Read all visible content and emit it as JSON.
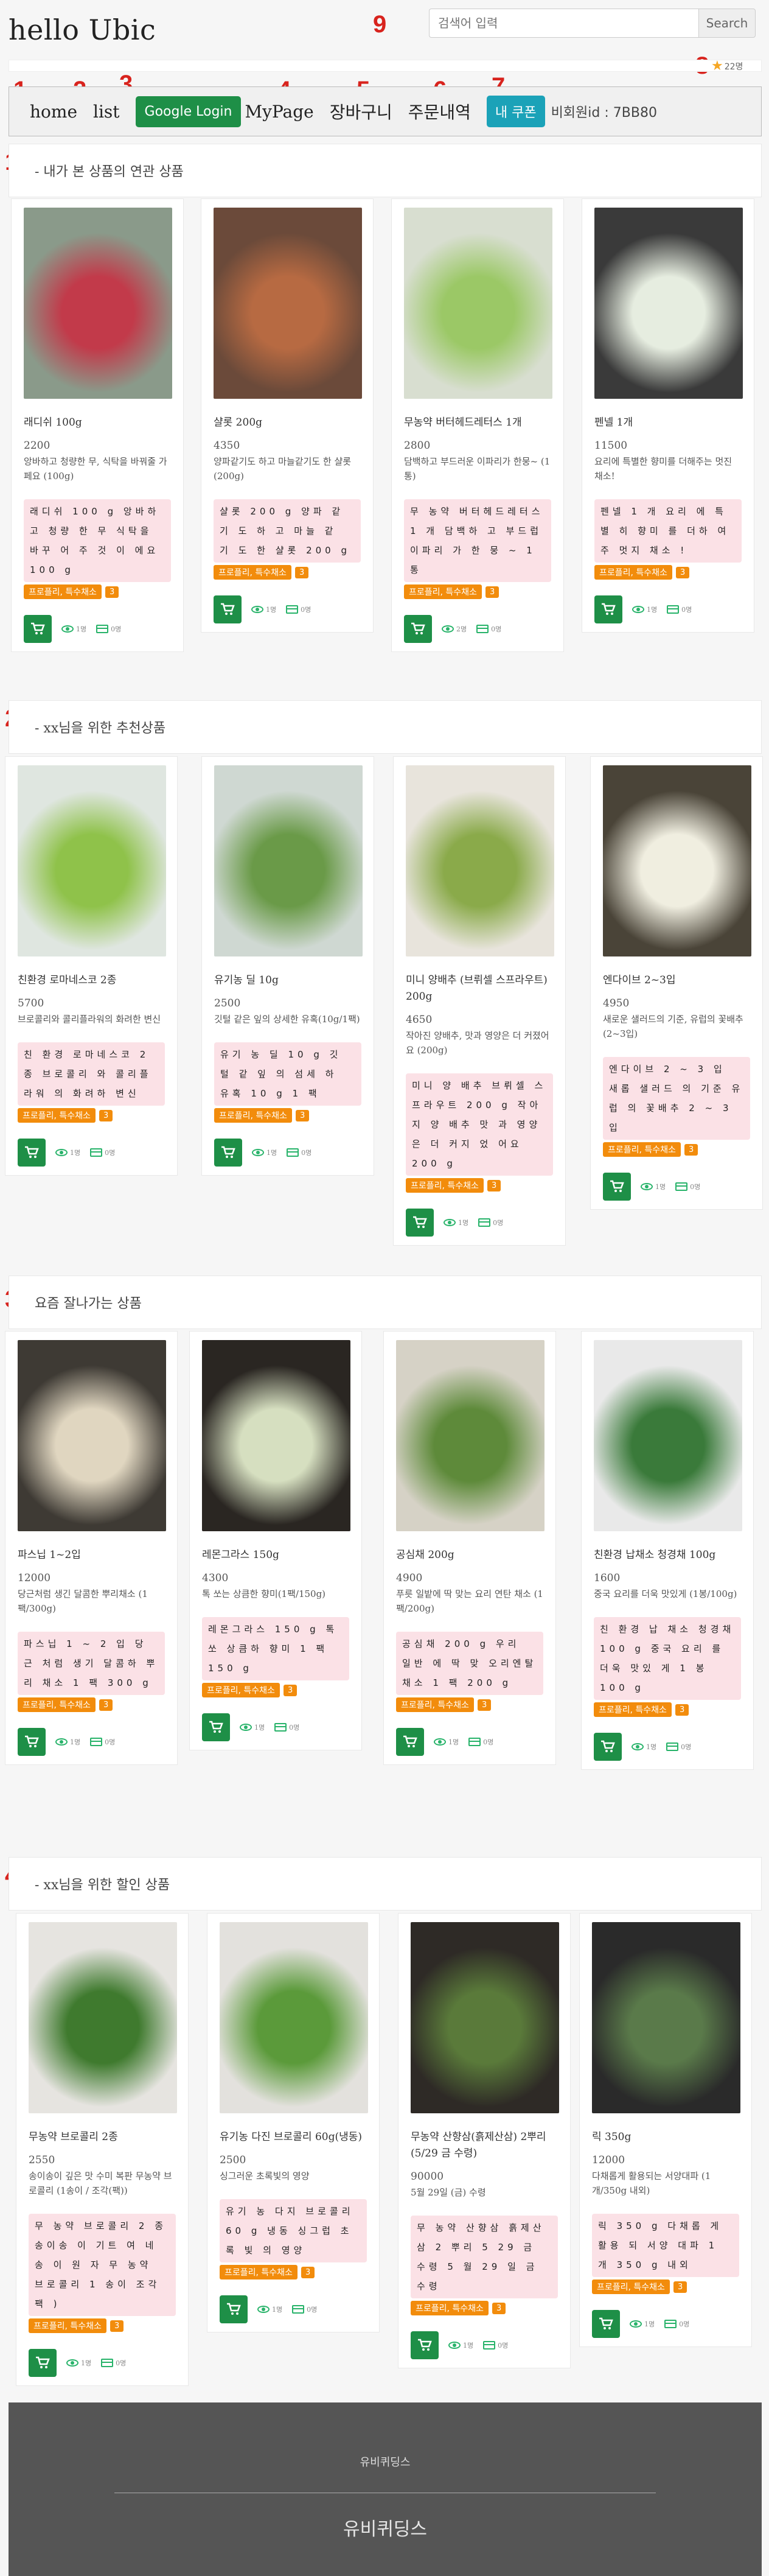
{
  "site": {
    "title": "hello Ubic"
  },
  "search": {
    "placeholder": "검색어 입력",
    "button": "Search"
  },
  "stat": {
    "count": "22명"
  },
  "nav": {
    "home": "home",
    "list": "list",
    "login": "Google Login",
    "mypage": "MyPage",
    "cart": "장바구니",
    "orders": "주문내역",
    "coupon": "내 쿠폰",
    "member": "비회원id : 7BB80"
  },
  "markers": [
    "1",
    "2",
    "3",
    "4",
    "5",
    "6",
    "7",
    "8",
    "9"
  ],
  "sections": [
    {
      "marker": "1",
      "title": "- 내가 본 상품의 연관 상품"
    },
    {
      "marker": "2",
      "title": "- xx님을 위한 추천상품"
    },
    {
      "marker": "3",
      "title": "요즘 잘나가는 상품"
    },
    {
      "marker": "4",
      "title": "- xx님을 위한 할인 상품"
    }
  ],
  "tags": {
    "store": "프로플리, 특수채소",
    "num": "3"
  },
  "products": [
    [
      {
        "name": "래디쉬 100g",
        "price": "2200",
        "desc": "앙바하고 청량한 무, 식탁을 바꿔줄 가페요 (100g)",
        "pink": "래디쉬 100 g 앙바하고 청량 한 무 식탁을 바꾸 어 주 것 이 에요 100 g",
        "views": "1명",
        "likes": "0명"
      },
      {
        "name": "샬롯 200g",
        "price": "4350",
        "desc": "양파같기도 하고 마늘같기도 한 샬롯 (200g)",
        "pink": "샬롯 200 g 양파 같 기 도 하 고 마늘 같 기 도 한 샬롯 200 g",
        "views": "1명",
        "likes": "0명"
      },
      {
        "name": "무농약 버터헤드레터스 1개",
        "price": "2800",
        "desc": "담백하고 부드러운 이파리가 한뭉~ (1통)",
        "pink": "무 농약 버터헤드레터스 1 개 담백하 고 부드럽 이파리 가 한 뭉 ~ 1 통",
        "views": "2명",
        "likes": "0명"
      },
      {
        "name": "펜넬 1개",
        "price": "11500",
        "desc": "요리에 특별한 향미를 더해주는 멋진 채소!",
        "pink": "펜넬 1 개 요리 에 특별 히 향미 를 더하 여 주 멋지 채소 !",
        "views": "1명",
        "likes": "0명"
      }
    ],
    [
      {
        "name": "친환경 로마네스코 2종",
        "price": "5700",
        "desc": "브로콜리와 콜리플라워의 화려한 변신",
        "pink": "친 환경 로마네스코 2 종 브로콜리 와 콜리플라워 의 화려하 변신",
        "views": "1명",
        "likes": "0명"
      },
      {
        "name": "유기농 딜 10g",
        "price": "2500",
        "desc": "깃털 같은 잎의 상세한 유혹(10g/1팩)",
        "pink": "유기 농 딜 10 g 깃 털 같 잎 의 섬세 하 유혹 10 g 1 팩",
        "views": "1명",
        "likes": "0명"
      },
      {
        "name": "미니 양배추 (브뤼셀 스프라우트) 200g",
        "price": "4650",
        "desc": "작아진 양배추, 맛과 영양은 더 커졌어요 (200g)",
        "pink": "미니 양 배추 브뤼셀 스프라우트 200 g 작아지 양 배추 맛 과 영양 은 더 커지 었 어요 200 g",
        "views": "1명",
        "likes": "0명"
      },
      {
        "name": "엔다이브 2~3입",
        "price": "4950",
        "desc": "새로운 샐러드의 기준, 유럽의 꽃배추 (2~3입)",
        "pink": "엔다이브 2 ~ 3 입 새롭 샐러드 의 기준 유럽 의 꽃배추 2 ~ 3 입",
        "views": "1명",
        "likes": "0명"
      }
    ],
    [
      {
        "name": "파스닙 1~2입",
        "price": "12000",
        "desc": "당근처럼 생긴 달콤한 뿌리채소 (1팩/300g)",
        "pink": "파스닙 1 ~ 2 입 당근 처럼 생기 달콤하 뿌리 채소 1 팩 300 g",
        "views": "1명",
        "likes": "0명"
      },
      {
        "name": "레몬그라스 150g",
        "price": "4300",
        "desc": "톡 쏘는 상큼한 향미(1팩/150g)",
        "pink": "레몬그라스 150 g 톡 쏘 상큼하 향미 1 팩 150 g",
        "views": "1명",
        "likes": "0명"
      },
      {
        "name": "공심채 200g",
        "price": "4900",
        "desc": "푸릇 일밭에 딱 맞는 요리 연탄 채소 (1팩/200g)",
        "pink": "공심채 200 g 우리 일반 에 딱 맞 오리엔탈 채소 1 팩 200 g",
        "views": "1명",
        "likes": "0명"
      },
      {
        "name": "친환경 납채소 청경채 100g",
        "price": "1600",
        "desc": "중국 요리를 더욱 맛있게 (1봉/100g)",
        "pink": "친 환경 납 채소 청경채 100 g 중국 요리 를 더욱 맛있 게 1 봉 100 g",
        "views": "1명",
        "likes": "0명"
      }
    ],
    [
      {
        "name": "무농약 브로콜리 2종",
        "price": "2550",
        "desc": "송이송이 깊은 맛 수미 복판 무농약 브로콜리 (1송이 / 조각(팩))",
        "pink": "무 농약 브로콜리 2 종 송이송 이 기트 여 네 송 이 원 자 무 농약 브로콜리 1 송이 조각 팩 )",
        "views": "1명",
        "likes": "0명"
      },
      {
        "name": "유기농 다진 브로콜리 60g(냉동)",
        "price": "2500",
        "desc": "싱그러운 초록빛의 영양",
        "pink": "유기 농 다지 브로콜리 60 g 냉동 싱그럽 초록 빛 의 영양",
        "views": "1명",
        "likes": "0명"
      },
      {
        "name": "무농약 산향삼(흙제산삼) 2뿌리 (5/29 금 수령)",
        "price": "90000",
        "desc": "5월 29일 (금) 수령",
        "pink": "무 농약 산향삼 흙제산삼 2 뿌리 5 29 금 수령 5 월 29 일 금 수령",
        "views": "1명",
        "likes": "0명"
      },
      {
        "name": "릭 350g",
        "price": "12000",
        "desc": "다채롭게 활용되는 서양대파 (1개/350g 내외)",
        "pink": "릭 350 g 다채롭 게 활용 되 서양 대파 1 개 350 g 내외",
        "views": "1명",
        "likes": "0명"
      }
    ]
  ],
  "footer": {
    "line1": "유비퀴딩스",
    "line2": "유비퀴딩스"
  }
}
